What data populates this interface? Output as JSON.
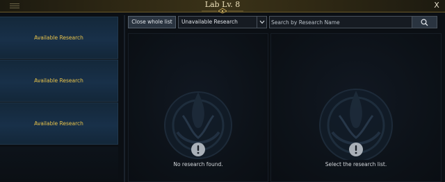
{
  "window": {
    "title": "Lab Lv. 8",
    "close_label": "X",
    "accent_color": "#efe3bd"
  },
  "left_list": {
    "items": [
      {
        "label": "Available Research"
      },
      {
        "label": "Available Research"
      },
      {
        "label": "Available Research"
      }
    ],
    "label_color": "#e8c34a"
  },
  "toolbar": {
    "close_list_label": "Close whole list",
    "filter": {
      "selected": "Unavailable Research",
      "icon": "chevron-down-icon"
    },
    "search": {
      "placeholder": "Search by Research Name",
      "value": "",
      "icon": "search-icon"
    }
  },
  "panels": {
    "left": {
      "message": "No research found.",
      "icon": "alert-icon"
    },
    "right": {
      "message": "Select the research list.",
      "icon": "alert-icon"
    }
  }
}
